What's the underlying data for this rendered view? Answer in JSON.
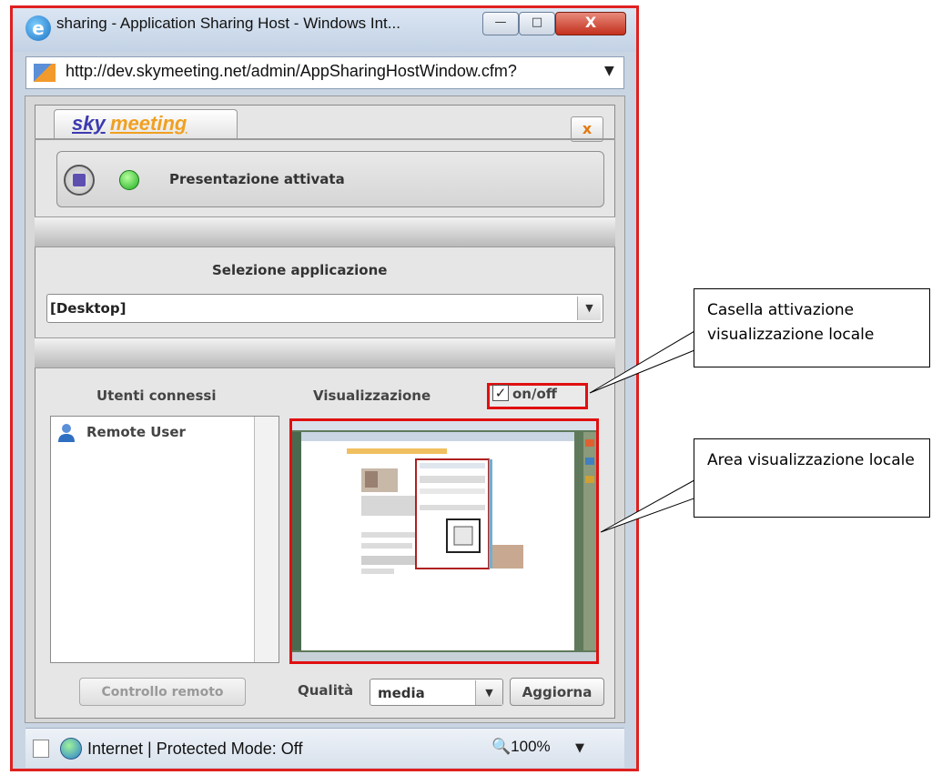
{
  "window": {
    "title": "sharing - Application Sharing Host - Windows Int...",
    "minimize": "—",
    "maximize": "□",
    "close": "X"
  },
  "address_bar": {
    "url": "http://dev.skymeeting.net/admin/AppSharingHostWindow.cfm?"
  },
  "app": {
    "logo_part1": "sky",
    "logo_part2": "meeting",
    "close_label": "x",
    "status_text": "Presentazione attivata",
    "selection_label": "Selezione applicazione",
    "selection_value": "[Desktop]",
    "users_label": "Utenti connessi",
    "view_label": "Visualizzazione",
    "toggle_label": "on/off",
    "toggle_checked": true,
    "users": [
      "Remote User"
    ],
    "remote_control_button": "Controllo remoto",
    "quality_label": "Qualità",
    "quality_value": "media",
    "update_button": "Aggiorna"
  },
  "statusbar": {
    "zone_text": "Internet | Protected Mode: Off",
    "zoom": "100%"
  },
  "callouts": {
    "toggle": "Casella attivazione visualizzazione locale",
    "preview": "Area visualizzazione locale"
  },
  "colors": {
    "highlight": "#e01010",
    "logo_blue": "#3c3ab0",
    "logo_orange": "#f0a020",
    "led_green": "#1fae20"
  }
}
